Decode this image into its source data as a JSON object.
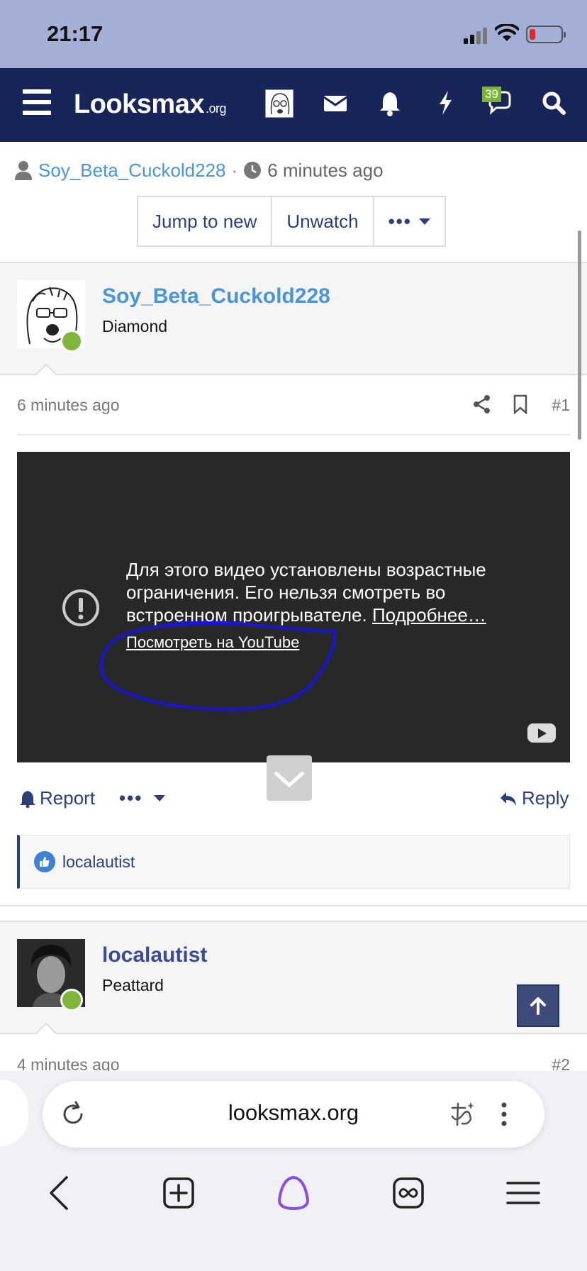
{
  "status_bar": {
    "time": "21:17"
  },
  "header": {
    "logo_main": "Looksmax",
    "logo_tld": ".org",
    "conversations_badge": "39"
  },
  "thread": {
    "author": "Soy_Beta_Cuckold228",
    "separator": "·",
    "time": "6 minutes ago",
    "buttons": {
      "jump_to_new": "Jump to new",
      "unwatch": "Unwatch",
      "more": "•••"
    }
  },
  "post1": {
    "username": "Soy_Beta_Cuckold228",
    "user_title": "Diamond",
    "time": "6 minutes ago",
    "number": "#1",
    "video": {
      "message": "Для этого видео установлены возрастные ограничения. Его нельзя смотреть во встроенном проигрывателе. ",
      "more_link": "Подробнее…",
      "youtube_link": "Посмотреть на YouTube"
    },
    "actions": {
      "report": "Report",
      "more": "•••",
      "reply": "Reply"
    },
    "reactions": {
      "users": "localautist"
    }
  },
  "post2": {
    "username": "localautist",
    "user_title": "Peattard",
    "time": "4 minutes ago",
    "number": "#2"
  },
  "browser": {
    "url": "looksmax.org"
  },
  "colors": {
    "header_bg": "#172558",
    "status_bg": "#a3afd6",
    "link_blue": "#4a95d8",
    "nav_blue": "#2d3f7a",
    "online_green": "#7db63a",
    "annotation_blue": "#1a14d8"
  }
}
